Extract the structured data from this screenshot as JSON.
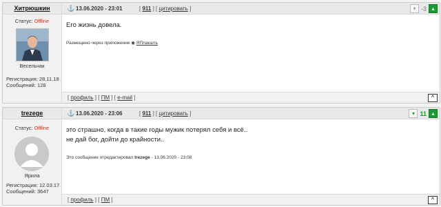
{
  "posts": [
    {
      "author": "Хитрюшкин",
      "status_label": "Статус:",
      "status_value": "Offline",
      "rank": "Весельчак",
      "reg_line": "Регистрация: 28.11.18",
      "msgs_line": "Сообщений: 128",
      "datetime": "13.06.2020 - 23:01",
      "post_no": "911",
      "quote": "цитировать",
      "votes": "-3",
      "body": [
        "Его жизнь довела."
      ],
      "note_prefix": "Размещено через приложение",
      "note_link": "ЯПлакалъ",
      "foot": [
        "профиль",
        "ПМ",
        "e-mail"
      ]
    },
    {
      "author": "trezege",
      "status_label": "Статус:",
      "status_value": "Offline",
      "rank": "Ярила",
      "reg_line": "Регистрация: 12.03.17",
      "msgs_line": "Сообщений: 3647",
      "datetime": "13.06.2020 - 23:06",
      "post_no": "911",
      "quote": "цитировать",
      "votes": "11",
      "body": [
        "это страшно, когда в такие годы мужик потерял себя и всё..",
        "не дай бог, дойти до крайности.."
      ],
      "edit_prefix": "Это сообщение отредактировал",
      "edit_user": "trezege",
      "edit_time": "- 13.06.2020 - 23:08",
      "foot": [
        "профиль",
        "ПМ"
      ]
    }
  ],
  "icons": {
    "anchor": "anchor-icon",
    "vote_down": "vote-down-icon",
    "vote_up": "vote-up-icon",
    "scroll_up": "scroll-up-icon"
  },
  "colors": {
    "offline": "#c0392b",
    "post_number": "#dd0000",
    "vote_up": "#1a9a2e"
  }
}
